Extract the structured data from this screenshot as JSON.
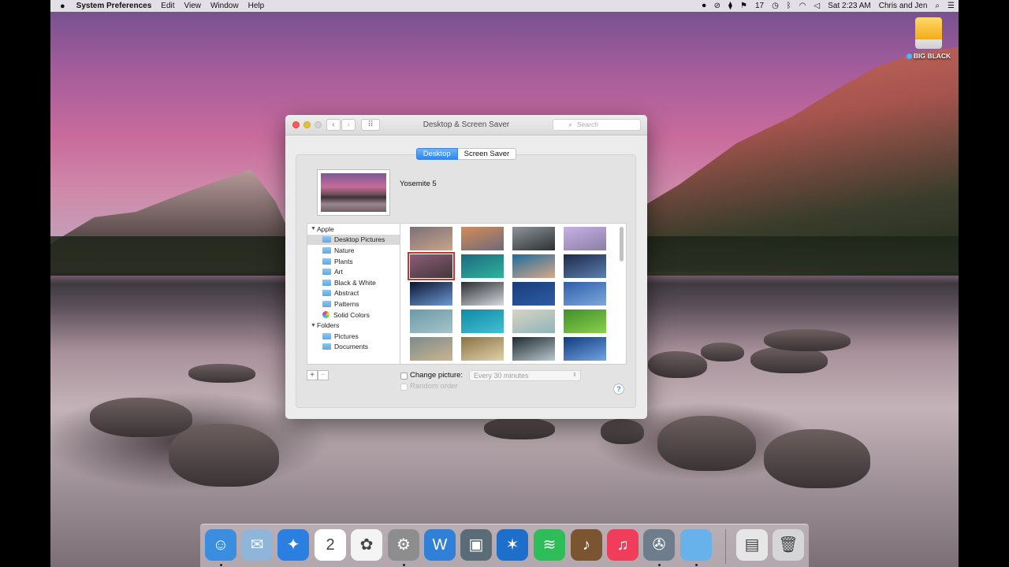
{
  "menubar": {
    "apple": "",
    "app": "System Preferences",
    "menus": [
      "Edit",
      "View",
      "Window",
      "Help"
    ],
    "status_badge": "17",
    "clock": "Sat 2:23 AM",
    "user": "Chris and Jen"
  },
  "desktop": {
    "drive_label": "BIG BLACK"
  },
  "window": {
    "title": "Desktop & Screen Saver",
    "search_placeholder": "Search",
    "tabs": [
      "Desktop",
      "Screen Saver"
    ],
    "active_tab": "Desktop",
    "current_wallpaper": "Yosemite 5",
    "sources": {
      "apple_group": "Apple",
      "apple_items": [
        "Desktop Pictures",
        "Nature",
        "Plants",
        "Art",
        "Black & White",
        "Abstract",
        "Patterns",
        "Solid Colors"
      ],
      "folders_group": "Folders",
      "folder_items": [
        "Pictures",
        "Documents"
      ],
      "selected": "Desktop Pictures"
    },
    "add_button": "+",
    "remove_button": "−",
    "change_picture_label": "Change picture:",
    "change_picture_checked": false,
    "interval_value": "Every 30 minutes",
    "random_order_label": "Random order",
    "help_button": "?",
    "thumbnails": [
      [
        "#7c6f76",
        "#c9a58a"
      ],
      [
        "#d48c58",
        "#6e6a7a"
      ],
      [
        "#8e9499",
        "#2d3133"
      ],
      [
        "#c8b0e8",
        "#8a7fa4"
      ],
      [
        "#8c5d7a",
        "#433638"
      ],
      [
        "#1d6a7d",
        "#2fb39e"
      ],
      [
        "#1f6b9b",
        "#d8a888"
      ],
      [
        "#1c2a4a",
        "#5c7fb0"
      ],
      [
        "#0c1630",
        "#6b9ad6"
      ],
      [
        "#2a2e33",
        "#d7d9dc"
      ],
      [
        "#1a3c7d",
        "#2d5da3"
      ],
      [
        "#2f5fa8",
        "#7da7de"
      ],
      [
        "#6c9aa8",
        "#a5c4c9"
      ],
      [
        "#0f8aa4",
        "#44c0d4"
      ],
      [
        "#d8d3c4",
        "#8fb5ba"
      ],
      [
        "#3f8f2b",
        "#8bcf4b"
      ],
      [
        "#7e8a8c",
        "#c9b58f"
      ],
      [
        "#8a7247",
        "#e0d2a8"
      ],
      [
        "#1e2a2d",
        "#b8c6cf"
      ],
      [
        "#143a7a",
        "#6fa5e6"
      ]
    ],
    "selected_thumbnail": 4
  },
  "dock": {
    "apps": [
      {
        "name": "Finder",
        "color": "#3b8de0",
        "glyph": "☺"
      },
      {
        "name": "Mail",
        "color": "#8fb6d9",
        "glyph": "✉"
      },
      {
        "name": "Safari",
        "color": "#2a7fe0",
        "glyph": "✦"
      },
      {
        "name": "Calendar",
        "color": "#ffffff",
        "glyph": "2"
      },
      {
        "name": "Photos",
        "color": "#f4f4f4",
        "glyph": "✿"
      },
      {
        "name": "System Preferences",
        "color": "#8d8d8d",
        "glyph": "⚙"
      },
      {
        "name": "Word",
        "color": "#2f80d6",
        "glyph": "W"
      },
      {
        "name": "Screen Sharing",
        "color": "#5b6b78",
        "glyph": "▣"
      },
      {
        "name": "App",
        "color": "#1e6fc9",
        "glyph": "✶"
      },
      {
        "name": "Spotify",
        "color": "#2ebd59",
        "glyph": "≋"
      },
      {
        "name": "GarageBand",
        "color": "#7a5530",
        "glyph": "♪"
      },
      {
        "name": "iTunes",
        "color": "#f03d5a",
        "glyph": "♫"
      },
      {
        "name": "iMovie",
        "color": "#6e7d8c",
        "glyph": "✇"
      },
      {
        "name": "Folder",
        "color": "#67b2ea",
        "glyph": ""
      },
      {
        "name": "Documents",
        "color": "#e6e6e6",
        "glyph": "▤"
      },
      {
        "name": "Trash",
        "color": "#d4d6d8",
        "glyph": "🗑"
      }
    ],
    "running": [
      0,
      5,
      12,
      13
    ]
  }
}
